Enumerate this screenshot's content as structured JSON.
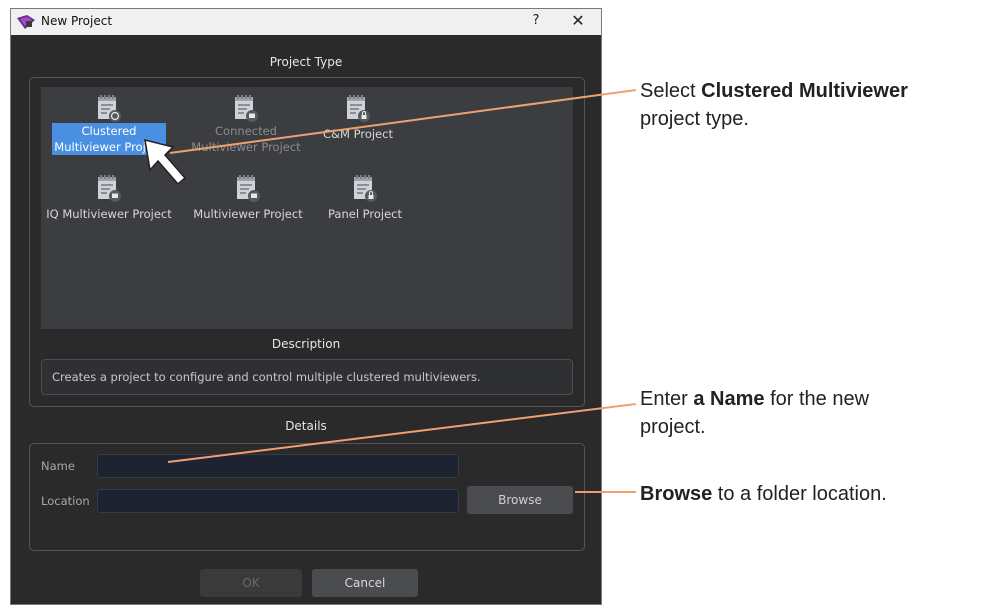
{
  "window": {
    "title": "New Project",
    "help_label": "?",
    "close_label": "✕"
  },
  "project_type": {
    "heading": "Project Type",
    "items": [
      {
        "line1": "Clustered",
        "line2": "Multiviewer Project",
        "badge": "globe"
      },
      {
        "line1": "Connected",
        "line2": "Multiviewer Project",
        "badge": "monitor"
      },
      {
        "line1": "C&M Project",
        "line2": "",
        "badge": "lock"
      },
      {
        "line1": "IQ Multiviewer Project",
        "line2": "",
        "badge": "monitor"
      },
      {
        "line1": "Multiviewer Project",
        "line2": "",
        "badge": "monitor"
      },
      {
        "line1": "Panel Project",
        "line2": "",
        "badge": "lock"
      }
    ]
  },
  "description": {
    "heading": "Description",
    "text": "Creates a project to configure and control multiple clustered multiviewers."
  },
  "details": {
    "heading": "Details",
    "name_label": "Name",
    "name_value": "",
    "location_label": "Location",
    "location_value": "",
    "browse_label": "Browse"
  },
  "actions": {
    "ok_label": "OK",
    "cancel_label": "Cancel"
  },
  "callouts": {
    "c1_pre": "Select ",
    "c1_bold": "Clustered Multiviewer",
    "c1_post": "project type.",
    "c2_pre": "Enter ",
    "c2_bold": "a Name",
    "c2_mid": " for the new",
    "c2_post": "project.",
    "c3_bold": "Browse",
    "c3_post": " to a folder location."
  },
  "colors": {
    "accent": "#4a90e2",
    "callout_line": "#f0a070",
    "dialog_bg": "#2a2a2a"
  }
}
